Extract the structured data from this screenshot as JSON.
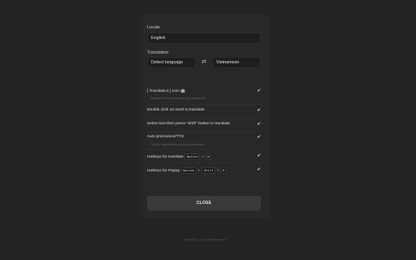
{
  "locale": {
    "label": "Locale",
    "value": "English"
  },
  "translation": {
    "label": "Translation",
    "source": "Detect language",
    "target": "Vietnamese",
    "swap_icon": "⇄"
  },
  "options": {
    "icon": {
      "label": "[ Translate.it ] Icon",
      "emoji": "🤖",
      "desc": "Show left to it an icon when you select text",
      "checked": "✔"
    },
    "dblclick": {
      "label": "Double click on word to translate",
      "checked": "✔"
    },
    "shift": {
      "label": "Select text then press \"Shift\" button to translate",
      "checked": "✔"
    },
    "tts": {
      "label": "Auto pronounce/TTS",
      "desc": "Only for word/dictionary not for sentences",
      "checked": "✔"
    },
    "hotkey_translate": {
      "label": "Hotkeys for translate",
      "keys": [
        "Option",
        "+",
        "W"
      ],
      "checked": "✔"
    },
    "hotkey_popup": {
      "label": "Hotkeys for Popup",
      "keys": [
        "Option",
        "+",
        "Shift",
        "+",
        "D"
      ],
      "checked": "✔"
    }
  },
  "close_label": "CLOSE",
  "footer": "Since 2020 - All rights reserved."
}
